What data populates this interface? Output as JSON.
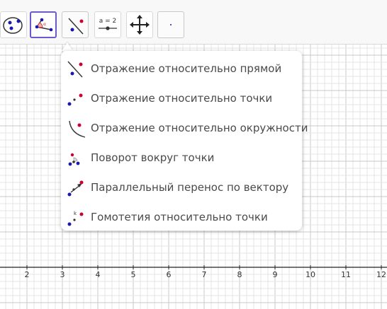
{
  "toolbar": {
    "tools": [
      {
        "name": "conic-tool"
      },
      {
        "name": "angle-tool"
      },
      {
        "name": "reflect-tool"
      },
      {
        "name": "slider-tool",
        "label": "a = 2"
      },
      {
        "name": "move-graphics-view-tool"
      },
      {
        "name": "empty-tool"
      }
    ]
  },
  "menu": {
    "items": [
      {
        "label": "Отражение относительно прямой",
        "icon": "reflect-about-line-icon"
      },
      {
        "label": "Отражение относительно точки",
        "icon": "reflect-about-point-icon"
      },
      {
        "label": "Отражение относительно окружности",
        "icon": "reflect-about-circle-icon"
      },
      {
        "label": "Поворот вокруг точки",
        "icon": "rotate-around-point-icon"
      },
      {
        "label": "Параллельный перенос по вектору",
        "icon": "translate-by-vector-icon"
      },
      {
        "label": "Гомотетия относительно точки",
        "icon": "dilate-from-point-icon"
      }
    ]
  },
  "axis": {
    "x_ticks": [
      "2",
      "3",
      "4",
      "5",
      "6",
      "7",
      "8",
      "9",
      "10",
      "11",
      "12"
    ]
  },
  "colors": {
    "point_blue": "#1a1aaa",
    "point_red": "#cc0033",
    "grid_minor": "#e6e6e6",
    "grid_major": "#c8c8c8",
    "selected_border": "#6a5acd"
  }
}
